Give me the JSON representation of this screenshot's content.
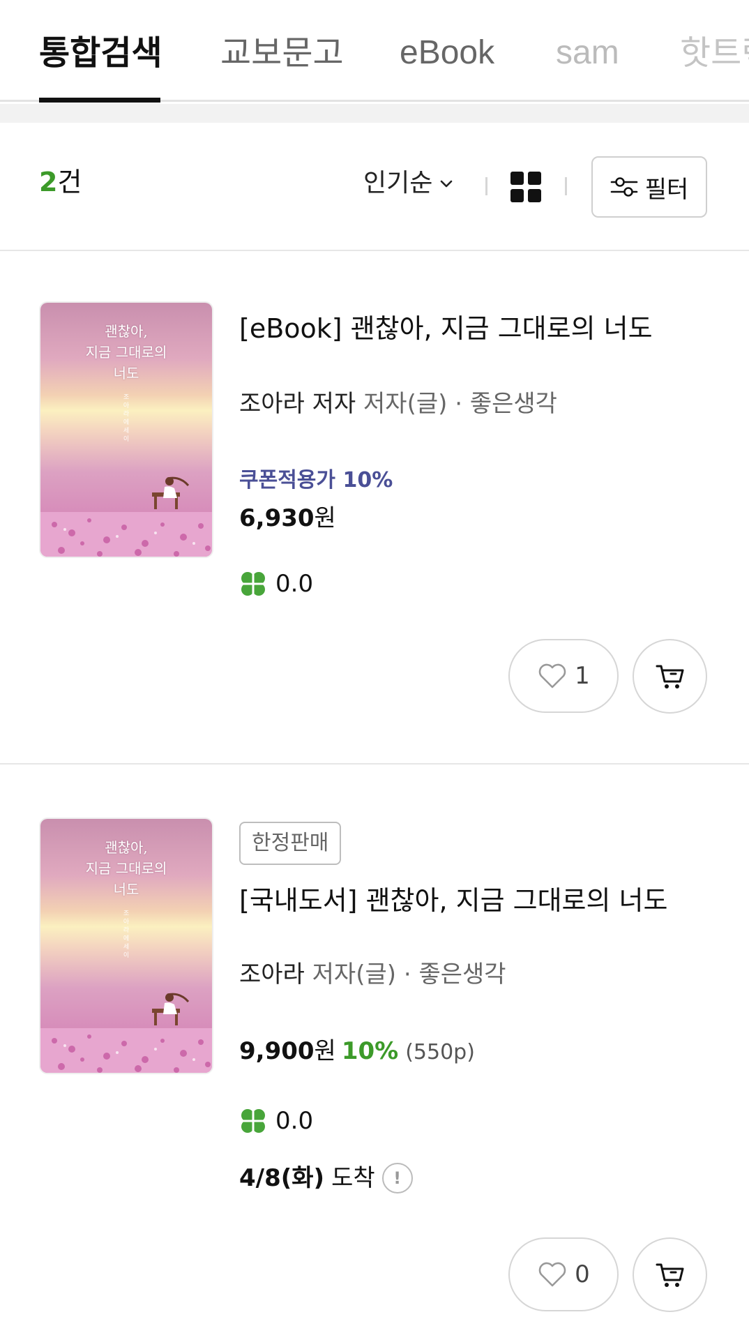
{
  "tabs": [
    {
      "label": "통합검색",
      "active": true
    },
    {
      "label": "교보문고",
      "active": false
    },
    {
      "label": "eBook",
      "active": false
    },
    {
      "label": "sam",
      "active": false
    },
    {
      "label": "핫트랙",
      "active": false
    }
  ],
  "toolbar": {
    "count_number": "2",
    "count_unit": "건",
    "sort_label": "인기순",
    "filter_label": "필터"
  },
  "products": [
    {
      "cover_title_lines": [
        "괜찮아,",
        "지금 그대로의",
        "너도"
      ],
      "cover_author": "조아라 에세이",
      "title": "[eBook] 괜찮아, 지금 그대로의 너도",
      "author": "조아라 저자",
      "meta": "저자(글) · 좋은생각",
      "coupon": "쿠폰적용가 10%",
      "price_number": "6,930",
      "price_unit": "원",
      "rating": "0.0",
      "likes": "1"
    },
    {
      "cover_title_lines": [
        "괜찮아,",
        "지금 그대로의",
        "너도"
      ],
      "cover_author": "조아라 에세이",
      "badge": "한정판매",
      "title": "[국내도서] 괜찮아, 지금 그대로의 너도",
      "author": "조아라",
      "meta": "저자(글) · 좋은생각",
      "price_number": "9,900",
      "price_unit": "원",
      "discount": "10%",
      "points": "(550p)",
      "rating": "0.0",
      "delivery_date": "4/8(화)",
      "delivery_label": "도착",
      "likes": "0"
    }
  ],
  "colors": {
    "accent_green": "#3c9a29",
    "coupon_blue": "#4a4f96",
    "tab_inactive": "#666666",
    "tab_faded": "#bbbbbb"
  },
  "icons": [
    "chevron-down-icon",
    "grid-view-icon",
    "filter-sliders-icon",
    "clover-icon",
    "heart-icon",
    "cart-icon",
    "info-icon"
  ]
}
